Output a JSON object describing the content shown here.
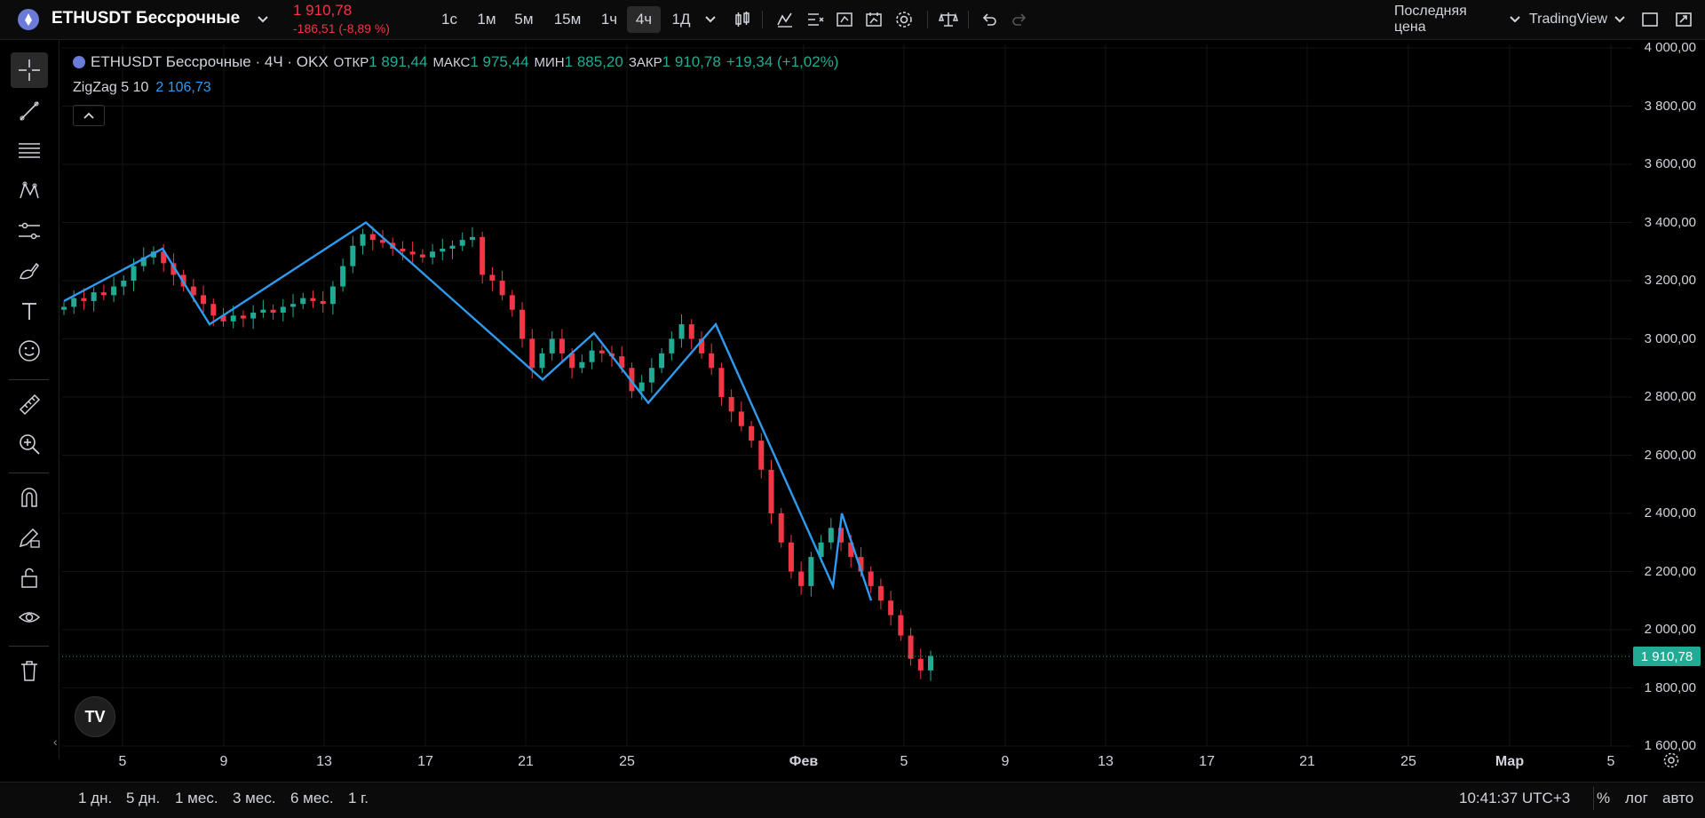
{
  "header": {
    "symbol": "ETHUSDT Бессрочные",
    "last_price": "1 910,78",
    "change": "-186,51 (-8,89 %)",
    "intervals": [
      "1с",
      "1м",
      "5м",
      "15м",
      "1ч",
      "4ч",
      "1Д"
    ],
    "active_interval": "4ч",
    "price_source": "Последняя цена",
    "provider": "TradingView"
  },
  "legend": {
    "title": "ETHUSDT Бессрочные · 4Ч · OKX",
    "open_label": "ОТКР",
    "open": "1 891,44",
    "high_label": "МАКС",
    "high": "1 975,44",
    "low_label": "МИН",
    "low": "1 885,20",
    "close_label": "ЗАКР",
    "close": "1 910,78",
    "change": "+19,34 (+1,02%)",
    "indicator": "ZigZag 5 10",
    "indicator_value": "2 106,73"
  },
  "price_axis": [
    "4 000,00",
    "3 800,00",
    "3 600,00",
    "3 400,00",
    "3 200,00",
    "3 000,00",
    "2 800,00",
    "2 600,00",
    "2 400,00",
    "2 200,00",
    "2 000,00",
    "1 800,00",
    "1 600,00"
  ],
  "current_price_tag": "1 910,78",
  "time_axis": [
    "5",
    "9",
    "13",
    "17",
    "21",
    "25",
    "Фев",
    "5",
    "9",
    "13",
    "17",
    "21",
    "25",
    "Мар",
    "5"
  ],
  "bottom": {
    "ranges": [
      "1 дн.",
      "5 дн.",
      "1 мес.",
      "3 мес.",
      "6 мес.",
      "1 г."
    ],
    "clock": "10:41:37 UTC+3",
    "percent": "%",
    "log": "лог",
    "auto": "авто"
  },
  "colors": {
    "up": "#22ab94",
    "down": "#f23645",
    "zigzag": "#2e9bf0",
    "background": "#000000"
  },
  "chart_data": {
    "type": "candlestick",
    "ylim": [
      1600,
      4000
    ],
    "zigzag": [
      3130,
      3310,
      3050,
      3400,
      2860,
      3020,
      2780,
      3050,
      2150,
      2400,
      2100
    ],
    "candles_close": [
      3110,
      3140,
      3130,
      3160,
      3150,
      3180,
      3200,
      3250,
      3280,
      3300,
      3260,
      3220,
      3180,
      3150,
      3120,
      3080,
      3060,
      3080,
      3070,
      3090,
      3100,
      3090,
      3110,
      3120,
      3140,
      3130,
      3120,
      3180,
      3250,
      3320,
      3360,
      3340,
      3330,
      3310,
      3300,
      3290,
      3280,
      3300,
      3310,
      3320,
      3340,
      3350,
      3220,
      3200,
      3150,
      3100,
      3000,
      2900,
      2950,
      3000,
      2950,
      2900,
      2920,
      2960,
      2950,
      2940,
      2900,
      2820,
      2850,
      2900,
      2950,
      3000,
      3050,
      3000,
      2950,
      2900,
      2800,
      2750,
      2700,
      2650,
      2550,
      2400,
      2300,
      2200,
      2150,
      2250,
      2300,
      2350,
      2300,
      2250,
      2200,
      2150,
      2100,
      2050,
      1980,
      1900,
      1860,
      1910
    ]
  }
}
